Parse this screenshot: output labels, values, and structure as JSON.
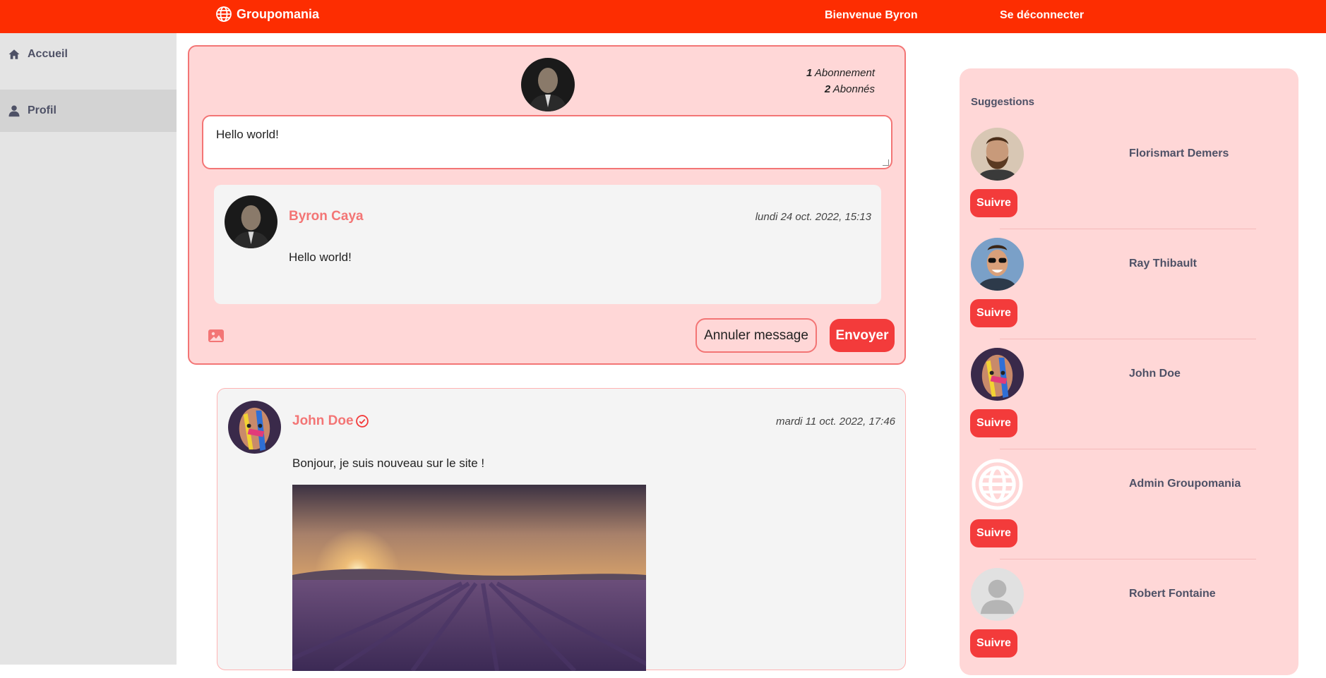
{
  "header": {
    "brand": "Groupomania",
    "welcome": "Bienvenue Byron",
    "logout": "Se déconnecter",
    "color": "#fd2d01"
  },
  "sidebar": {
    "items": [
      {
        "label": "Accueil",
        "icon": "home-icon"
      },
      {
        "label": "Profil",
        "icon": "user-icon"
      }
    ]
  },
  "composer": {
    "follow_count": "1",
    "follow_label": "Abonnement",
    "follower_count": "2",
    "follower_label": "Abonnés",
    "input_value": "Hello world!",
    "preview": {
      "author": "Byron Caya",
      "date": "lundi 24 oct. 2022, 15:13",
      "text": "Hello world!"
    },
    "cancel_label": "Annuler message",
    "send_label": "Envoyer",
    "image_icon": "image-icon"
  },
  "post": {
    "author": "John Doe",
    "date": "mardi 11 oct. 2022, 17:46",
    "text": "Bonjour, je suis nouveau sur le site !",
    "verified_icon": "check-circle-icon"
  },
  "suggestions": {
    "title": "Suggestions",
    "follow_label": "Suivre",
    "people": [
      {
        "name": "Florismart Demers"
      },
      {
        "name": "Ray Thibault"
      },
      {
        "name": "John Doe"
      },
      {
        "name": "Admin Groupomania"
      },
      {
        "name": "Robert Fontaine"
      }
    ]
  },
  "colors": {
    "accent": "#f33b3b",
    "pink_bg": "#ffd7d7",
    "pink_border": "#f37575",
    "text_dark": "#4e5166"
  }
}
